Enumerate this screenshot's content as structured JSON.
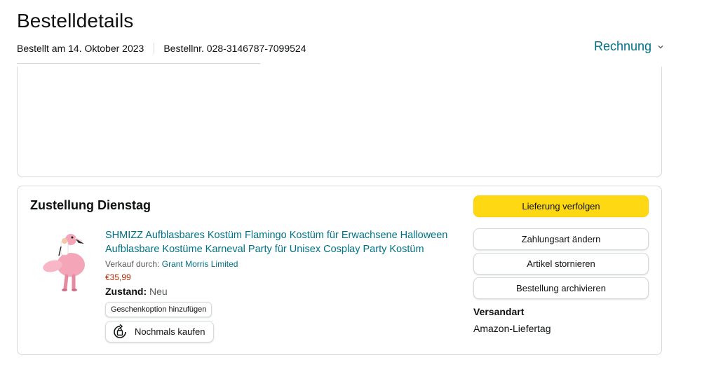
{
  "header": {
    "title": "Bestelldetails",
    "order_date": "Bestellt am 14. Oktober 2023",
    "order_number": "Bestellnr. 028-3146787-7099524",
    "invoice_label": "Rechnung"
  },
  "shipment": {
    "delivery_title": "Zustellung Dienstag",
    "product": {
      "title": "SHMIZZ Aufblasbares Kostüm Flamingo Kostüm für Erwachsene Halloween Aufblasbare Kostüme Karneval Party für Unisex Cosplay Party Kostüm",
      "image_icon": "flamingo-costume-image",
      "seller_prefix": "Verkauf durch:",
      "seller_name": "Grant Morris Limited",
      "price": "€35,99",
      "condition_label": "Zustand:",
      "condition_value": "Neu",
      "gift_option": "Geschenkoption hinzufügen",
      "buy_again": "Nochmals kaufen"
    },
    "actions": {
      "track": "Lieferung verfolgen",
      "change_payment": "Zahlungsart ändern",
      "cancel_items": "Artikel stornieren",
      "archive_order": "Bestellung archivieren"
    },
    "shipping_method_label": "Versandart",
    "shipping_method_value": "Amazon-Liefertag"
  },
  "colors": {
    "link": "#007185",
    "primary_button": "#ffd814",
    "price": "#b12704",
    "border": "#d5d9d9"
  }
}
